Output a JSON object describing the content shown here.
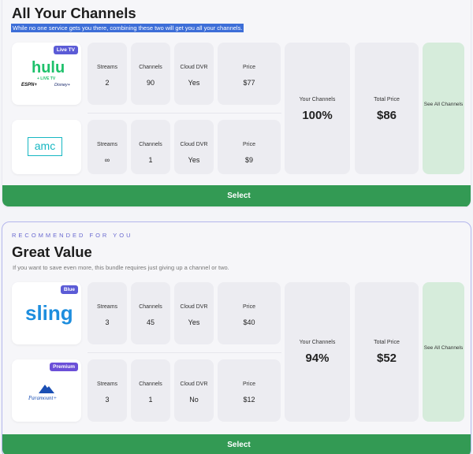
{
  "bundles": [
    {
      "eyebrow": "",
      "title": "All Your Channels",
      "subtitle": "While no one service gets you there, combining these two will get you all your channels.",
      "services": [
        {
          "name": "hulu",
          "logo": "hulu-logo",
          "badge": "Live TV",
          "badge_color": "#5b5bd6",
          "metrics": [
            {
              "label": "Streams",
              "value": "2"
            },
            {
              "label": "Channels",
              "value": "90"
            },
            {
              "label": "Cloud DVR",
              "value": "Yes"
            },
            {
              "label": "Price",
              "value": "$77"
            }
          ]
        },
        {
          "name": "amc",
          "logo": "amc-logo",
          "badge": "",
          "metrics": [
            {
              "label": "Streams",
              "value": "∞"
            },
            {
              "label": "Channels",
              "value": "1"
            },
            {
              "label": "Cloud DVR",
              "value": "Yes"
            },
            {
              "label": "Price",
              "value": "$9"
            }
          ]
        }
      ],
      "your_channels": {
        "label": "Your Channels",
        "value": "100%"
      },
      "total_price": {
        "label": "Total Price",
        "value": "$86"
      },
      "see_all": "See All Channels",
      "select": "Select"
    },
    {
      "eyebrow": "RECOMMENDED FOR YOU",
      "title": "Great Value",
      "subtitle": "If you want to save even more, this bundle requires just giving up a channel or two.",
      "services": [
        {
          "name": "sling",
          "logo": "sling-logo",
          "badge": "Blue",
          "badge_color": "#5b5bd6",
          "metrics": [
            {
              "label": "Streams",
              "value": "3"
            },
            {
              "label": "Channels",
              "value": "45"
            },
            {
              "label": "Cloud DVR",
              "value": "Yes"
            },
            {
              "label": "Price",
              "value": "$40"
            }
          ]
        },
        {
          "name": "paramount",
          "logo": "paramount-logo",
          "badge": "Premium",
          "badge_color": "#6b4fd8",
          "metrics": [
            {
              "label": "Streams",
              "value": "3"
            },
            {
              "label": "Channels",
              "value": "1"
            },
            {
              "label": "Cloud DVR",
              "value": "No"
            },
            {
              "label": "Price",
              "value": "$12"
            }
          ]
        }
      ],
      "your_channels": {
        "label": "Your Channels",
        "value": "94%"
      },
      "total_price": {
        "label": "Total Price",
        "value": "$52"
      },
      "see_all": "See All Channels",
      "select": "Select"
    }
  ],
  "logos": {
    "hulu_word": "hulu",
    "hulu_live": "+ LIVE TV",
    "hulu_espn": "ESPN+",
    "hulu_disney": "Disney+",
    "amc_word": "amc",
    "sling_word": "sling",
    "paramount_word": "Paramount+"
  }
}
